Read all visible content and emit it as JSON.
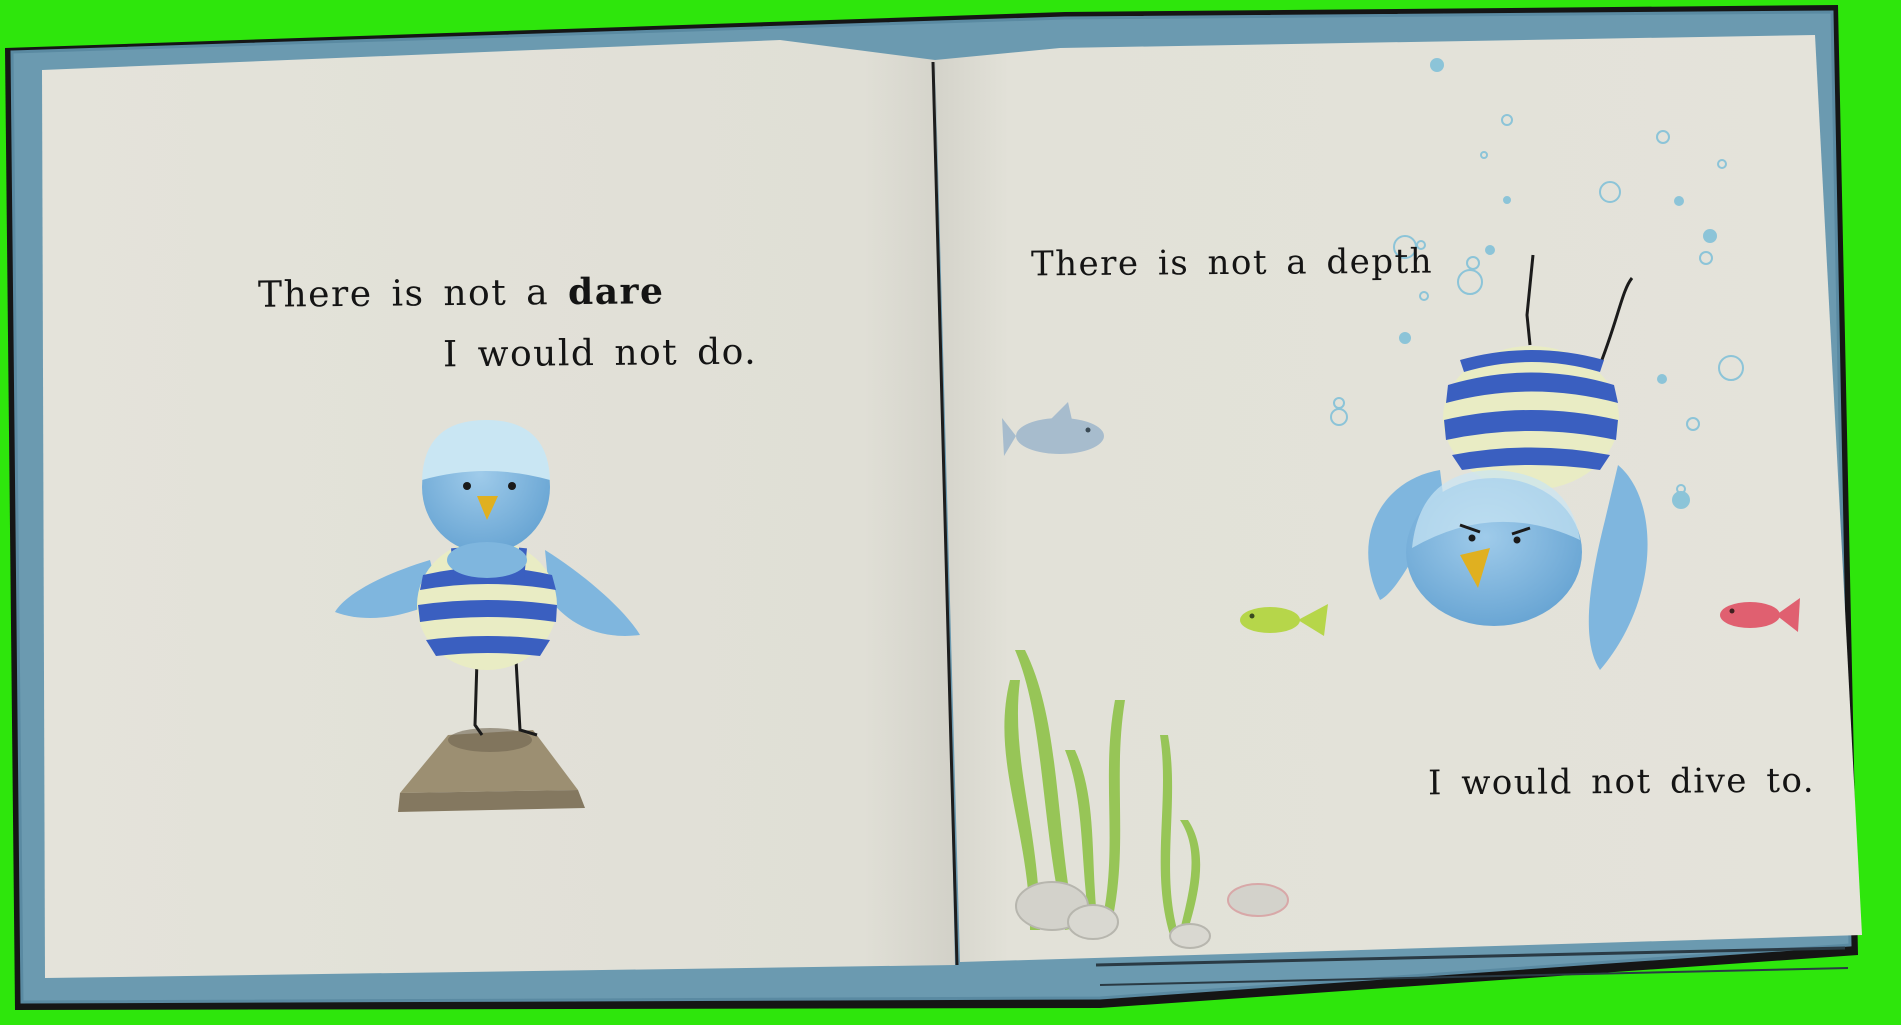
{
  "left_page": {
    "line1_prefix": "There is not a ",
    "line1_bold": "dare",
    "line2": "I would not do."
  },
  "right_page": {
    "line1": "There is not a depth",
    "line2": "I would not dive to."
  },
  "colors": {
    "background": "#2ee60c",
    "cover": "#6b9ab0",
    "page": "#e2e1d8",
    "bird": "#7fb6de",
    "stripe_blue": "#3a5fc0",
    "stripe_cream": "#e9ecc4",
    "beak": "#e0b020",
    "board": "#9c8f72",
    "seaweed": "#8fc24a",
    "fish_green": "#b6d64a",
    "fish_red": "#e06070",
    "fish_grey": "#a7bccd"
  },
  "icons": [
    "bird-on-diving-board",
    "diving-bird",
    "fish",
    "seaweed",
    "pebbles",
    "bubbles"
  ]
}
